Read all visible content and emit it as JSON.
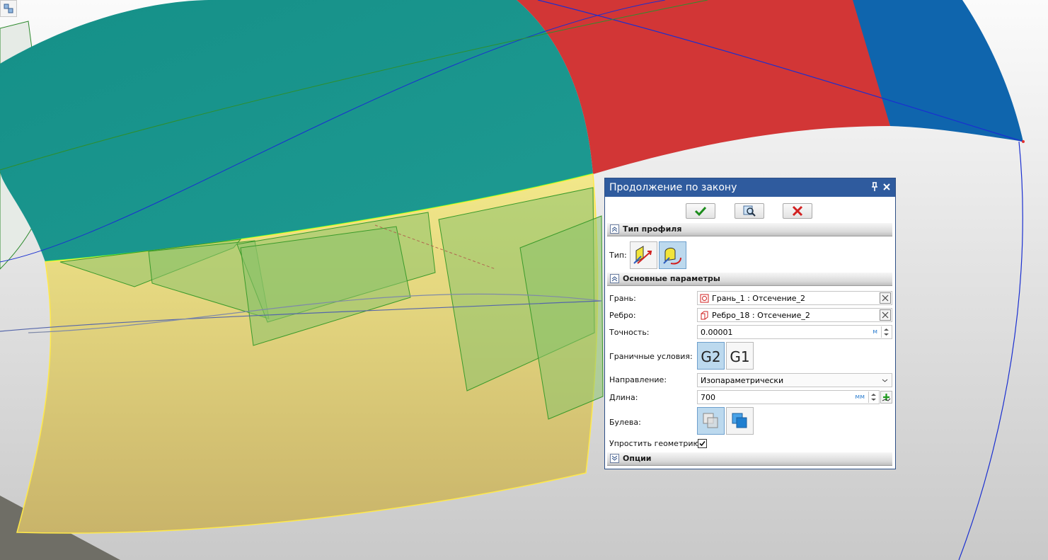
{
  "panel": {
    "title": "Продолжение по закону",
    "sections": {
      "profile_type": "Тип профиля",
      "main_params": "Основные параметры",
      "options": "Опции"
    },
    "type_label": "Тип:",
    "face": {
      "label": "Грань:",
      "value": "Грань_1 : Отсечение_2"
    },
    "edge": {
      "label": "Ребро:",
      "value": "Ребро_18 : Отсечение_2"
    },
    "precision": {
      "label": "Точность:",
      "value": "0.00001",
      "unit": "м"
    },
    "boundary": {
      "label": "Граничные условия:",
      "g2": "G2",
      "g1": "G1",
      "selected": "G2"
    },
    "direction": {
      "label": "Направление:",
      "value": "Изопараметрически"
    },
    "length": {
      "label": "Длина:",
      "value": "700",
      "unit": "мм"
    },
    "boolean": {
      "label": "Булева:"
    },
    "simplify": {
      "label": "Упростить геометрию:",
      "checked": true
    }
  },
  "colors": {
    "teal": "#1a9790",
    "red": "#d03434",
    "blue": "#0d64ad",
    "yellow": "#ece07c",
    "green_patch": "#8fc570",
    "title_bar": "#2f5b9e"
  }
}
